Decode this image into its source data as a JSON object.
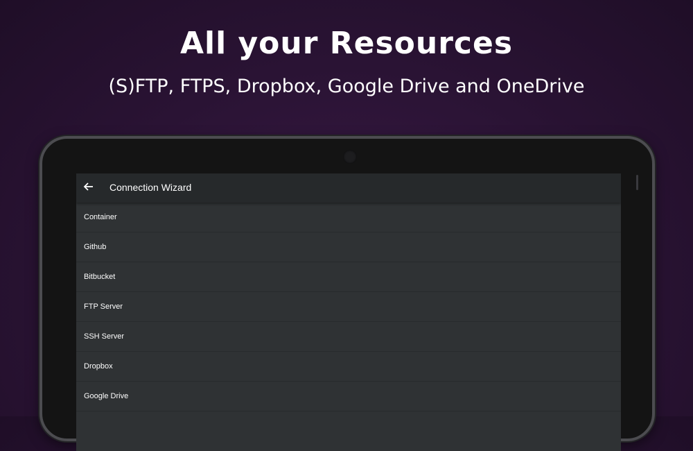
{
  "promo": {
    "headline": "All your Resources",
    "subheadline": "(S)FTP, FTPS, Dropbox, Google Drive and OneDrive"
  },
  "appbar": {
    "back_icon": "arrow-back-icon",
    "title": "Connection Wizard"
  },
  "list": {
    "items": [
      {
        "label": "Container"
      },
      {
        "label": "Github"
      },
      {
        "label": "Bitbucket"
      },
      {
        "label": "FTP Server"
      },
      {
        "label": "SSH Server"
      },
      {
        "label": "Dropbox"
      },
      {
        "label": "Google Drive"
      }
    ]
  },
  "colors": {
    "background": "#2a1334",
    "appbar": "#26292b",
    "list_background": "#2f3234",
    "text": "#ffffff"
  }
}
